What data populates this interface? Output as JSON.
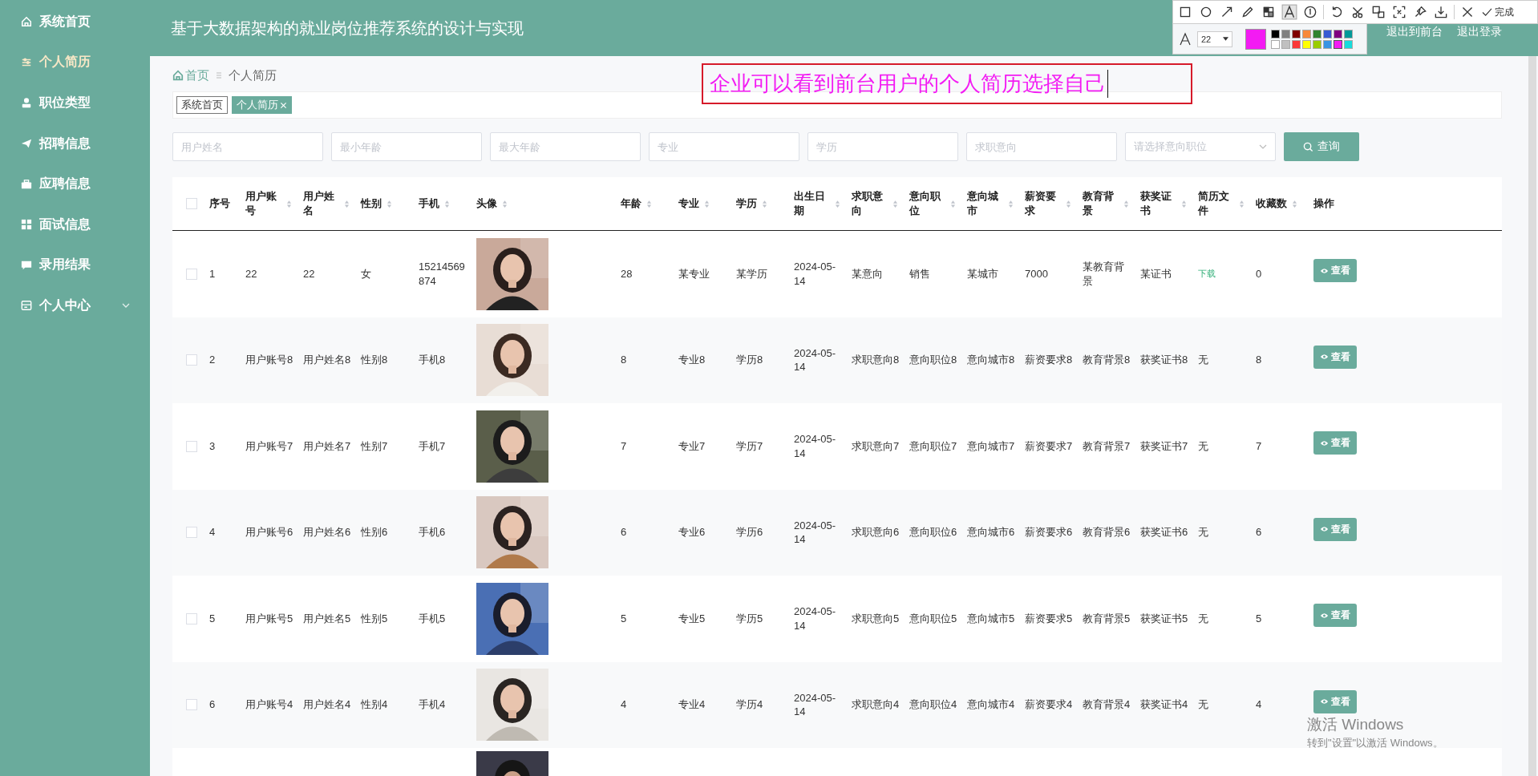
{
  "header": {
    "title": "基于大数据架构的就业岗位推荐系统的设计与实现",
    "links": [
      "退出到前台",
      "退出登录"
    ]
  },
  "sidebar": {
    "items": [
      {
        "label": "系统首页",
        "selected": false,
        "has_submenu": false
      },
      {
        "label": "个人简历",
        "selected": true,
        "has_submenu": false
      },
      {
        "label": "职位类型",
        "selected": false,
        "has_submenu": false
      },
      {
        "label": "招聘信息",
        "selected": false,
        "has_submenu": false
      },
      {
        "label": "应聘信息",
        "selected": false,
        "has_submenu": false
      },
      {
        "label": "面试信息",
        "selected": false,
        "has_submenu": false
      },
      {
        "label": "录用结果",
        "selected": false,
        "has_submenu": false
      },
      {
        "label": "个人中心",
        "selected": false,
        "has_submenu": true
      }
    ]
  },
  "breadcrumb": {
    "home": "首页",
    "current": "个人简历"
  },
  "tags": [
    {
      "label": "系统首页",
      "selected": false,
      "closable": false
    },
    {
      "label": "个人简历",
      "selected": true,
      "closable": true
    }
  ],
  "filters": [
    {
      "placeholder": "用户姓名",
      "kind": "input"
    },
    {
      "placeholder": "最小年龄",
      "kind": "input"
    },
    {
      "placeholder": "最大年龄",
      "kind": "input"
    },
    {
      "placeholder": "专业",
      "kind": "input"
    },
    {
      "placeholder": "学历",
      "kind": "input"
    },
    {
      "placeholder": "求职意向",
      "kind": "input"
    },
    {
      "placeholder": "请选择意向职位",
      "kind": "select"
    }
  ],
  "search_button": "查询",
  "table": {
    "select_all": {
      "checked": false
    },
    "columns": [
      {
        "label": "序号",
        "kind": "text",
        "sortable": false
      },
      {
        "label": "用户账号",
        "kind": "text",
        "sortable": true
      },
      {
        "label": "用户姓名",
        "kind": "text",
        "sortable": true
      },
      {
        "label": "性别",
        "kind": "text",
        "sortable": true
      },
      {
        "label": "手机",
        "kind": "text",
        "sortable": true
      },
      {
        "label": "头像",
        "kind": "avatar",
        "sortable": true
      },
      {
        "label": "年龄",
        "kind": "text",
        "sortable": true
      },
      {
        "label": "专业",
        "kind": "text",
        "sortable": true
      },
      {
        "label": "学历",
        "kind": "text",
        "sortable": true
      },
      {
        "label": "出生日期",
        "kind": "text",
        "sortable": true
      },
      {
        "label": "求职意向",
        "kind": "text",
        "sortable": true
      },
      {
        "label": "意向职位",
        "kind": "text",
        "sortable": true
      },
      {
        "label": "意向城市",
        "kind": "text",
        "sortable": true
      },
      {
        "label": "薪资要求",
        "kind": "text",
        "sortable": true
      },
      {
        "label": "教育背景",
        "kind": "text",
        "sortable": true
      },
      {
        "label": "获奖证书",
        "kind": "text",
        "sortable": true
      },
      {
        "label": "简历文件",
        "kind": "file",
        "sortable": true
      },
      {
        "label": "收藏数",
        "kind": "text",
        "sortable": true
      },
      {
        "label": "操作",
        "kind": "action",
        "sortable": false
      }
    ],
    "rows": [
      {
        "checked": false,
        "cells": [
          "1",
          "22",
          "22",
          "女",
          "15214569874",
          {
            "kind": "picture"
          },
          "28",
          "某专业",
          "某学历",
          "2024-05-14",
          "某意向",
          "销售",
          "某城市",
          "7000",
          "某教育背景",
          "某证书",
          {
            "text": "下载",
            "kind": "link"
          },
          "0",
          "查看"
        ]
      },
      {
        "checked": false,
        "cells": [
          "2",
          "用户账号8",
          "用户姓名8",
          "性别8",
          "手机8",
          {
            "kind": "picture"
          },
          "8",
          "专业8",
          "学历8",
          "2024-05-14",
          "求职意向8",
          "意向职位8",
          "意向城市8",
          "薪资要求8",
          "教育背景8",
          "获奖证书8",
          {
            "text": "无",
            "kind": "plain"
          },
          "8",
          "查看"
        ]
      },
      {
        "checked": false,
        "cells": [
          "3",
          "用户账号7",
          "用户姓名7",
          "性别7",
          "手机7",
          {
            "kind": "picture"
          },
          "7",
          "专业7",
          "学历7",
          "2024-05-14",
          "求职意向7",
          "意向职位7",
          "意向城市7",
          "薪资要求7",
          "教育背景7",
          "获奖证书7",
          {
            "text": "无",
            "kind": "plain"
          },
          "7",
          "查看"
        ]
      },
      {
        "checked": false,
        "cells": [
          "4",
          "用户账号6",
          "用户姓名6",
          "性别6",
          "手机6",
          {
            "kind": "picture"
          },
          "6",
          "专业6",
          "学历6",
          "2024-05-14",
          "求职意向6",
          "意向职位6",
          "意向城市6",
          "薪资要求6",
          "教育背景6",
          "获奖证书6",
          {
            "text": "无",
            "kind": "plain"
          },
          "6",
          "查看"
        ]
      },
      {
        "checked": false,
        "cells": [
          "5",
          "用户账号5",
          "用户姓名5",
          "性别5",
          "手机5",
          {
            "kind": "picture"
          },
          "5",
          "专业5",
          "学历5",
          "2024-05-14",
          "求职意向5",
          "意向职位5",
          "意向城市5",
          "薪资要求5",
          "教育背景5",
          "获奖证书5",
          {
            "text": "无",
            "kind": "plain"
          },
          "5",
          "查看"
        ]
      },
      {
        "checked": false,
        "cells": [
          "6",
          "用户账号4",
          "用户姓名4",
          "性别4",
          "手机4",
          {
            "kind": "picture"
          },
          "4",
          "专业4",
          "学历4",
          "2024-05-14",
          "求职意向4",
          "意向职位4",
          "意向城市4",
          "薪资要求4",
          "教育背景4",
          "获奖证书4",
          {
            "text": "无",
            "kind": "plain"
          },
          "4",
          "查看"
        ]
      }
    ],
    "partial_row": {
      "avatar": {
        "kind": "picture"
      }
    }
  },
  "annotation": {
    "text": "企业可以看到前台用户的个人简历选择自己"
  },
  "screenshot_toolbar": {
    "tools": [
      {
        "selected": false
      },
      {
        "selected": false
      },
      {
        "selected": false
      },
      {
        "selected": false
      },
      {
        "selected": false
      },
      {
        "selected": true
      },
      {
        "selected": false
      },
      {
        "selected": false
      },
      {
        "selected": false
      },
      {
        "selected": false
      },
      {
        "selected": false
      },
      {
        "selected": false
      },
      {
        "selected": false
      },
      {
        "selected": false
      }
    ],
    "done_label": "完成",
    "font_size": "22",
    "palette": [
      {
        "color": "#000000",
        "selected": false
      },
      {
        "color": "#808080",
        "selected": false
      },
      {
        "color": "#800000",
        "selected": false
      },
      {
        "color": "#f7883a",
        "selected": false
      },
      {
        "color": "#308430",
        "selected": false
      },
      {
        "color": "#385ad3",
        "selected": false
      },
      {
        "color": "#800080",
        "selected": false
      },
      {
        "color": "#009999",
        "selected": false
      },
      {
        "color": "#ffffff",
        "selected": false
      },
      {
        "color": "#c0c0c0",
        "selected": false
      },
      {
        "color": "#fb3838",
        "selected": false
      },
      {
        "color": "#ffff00",
        "selected": false
      },
      {
        "color": "#99cc00",
        "selected": false
      },
      {
        "color": "#3894e4",
        "selected": false
      },
      {
        "color": "#f31bf3",
        "selected": true
      },
      {
        "color": "#16dcdc",
        "selected": false
      }
    ]
  },
  "os_notice": {
    "title": "激活 Windows",
    "text": "转到\"设置\"以激活 Windows。"
  }
}
